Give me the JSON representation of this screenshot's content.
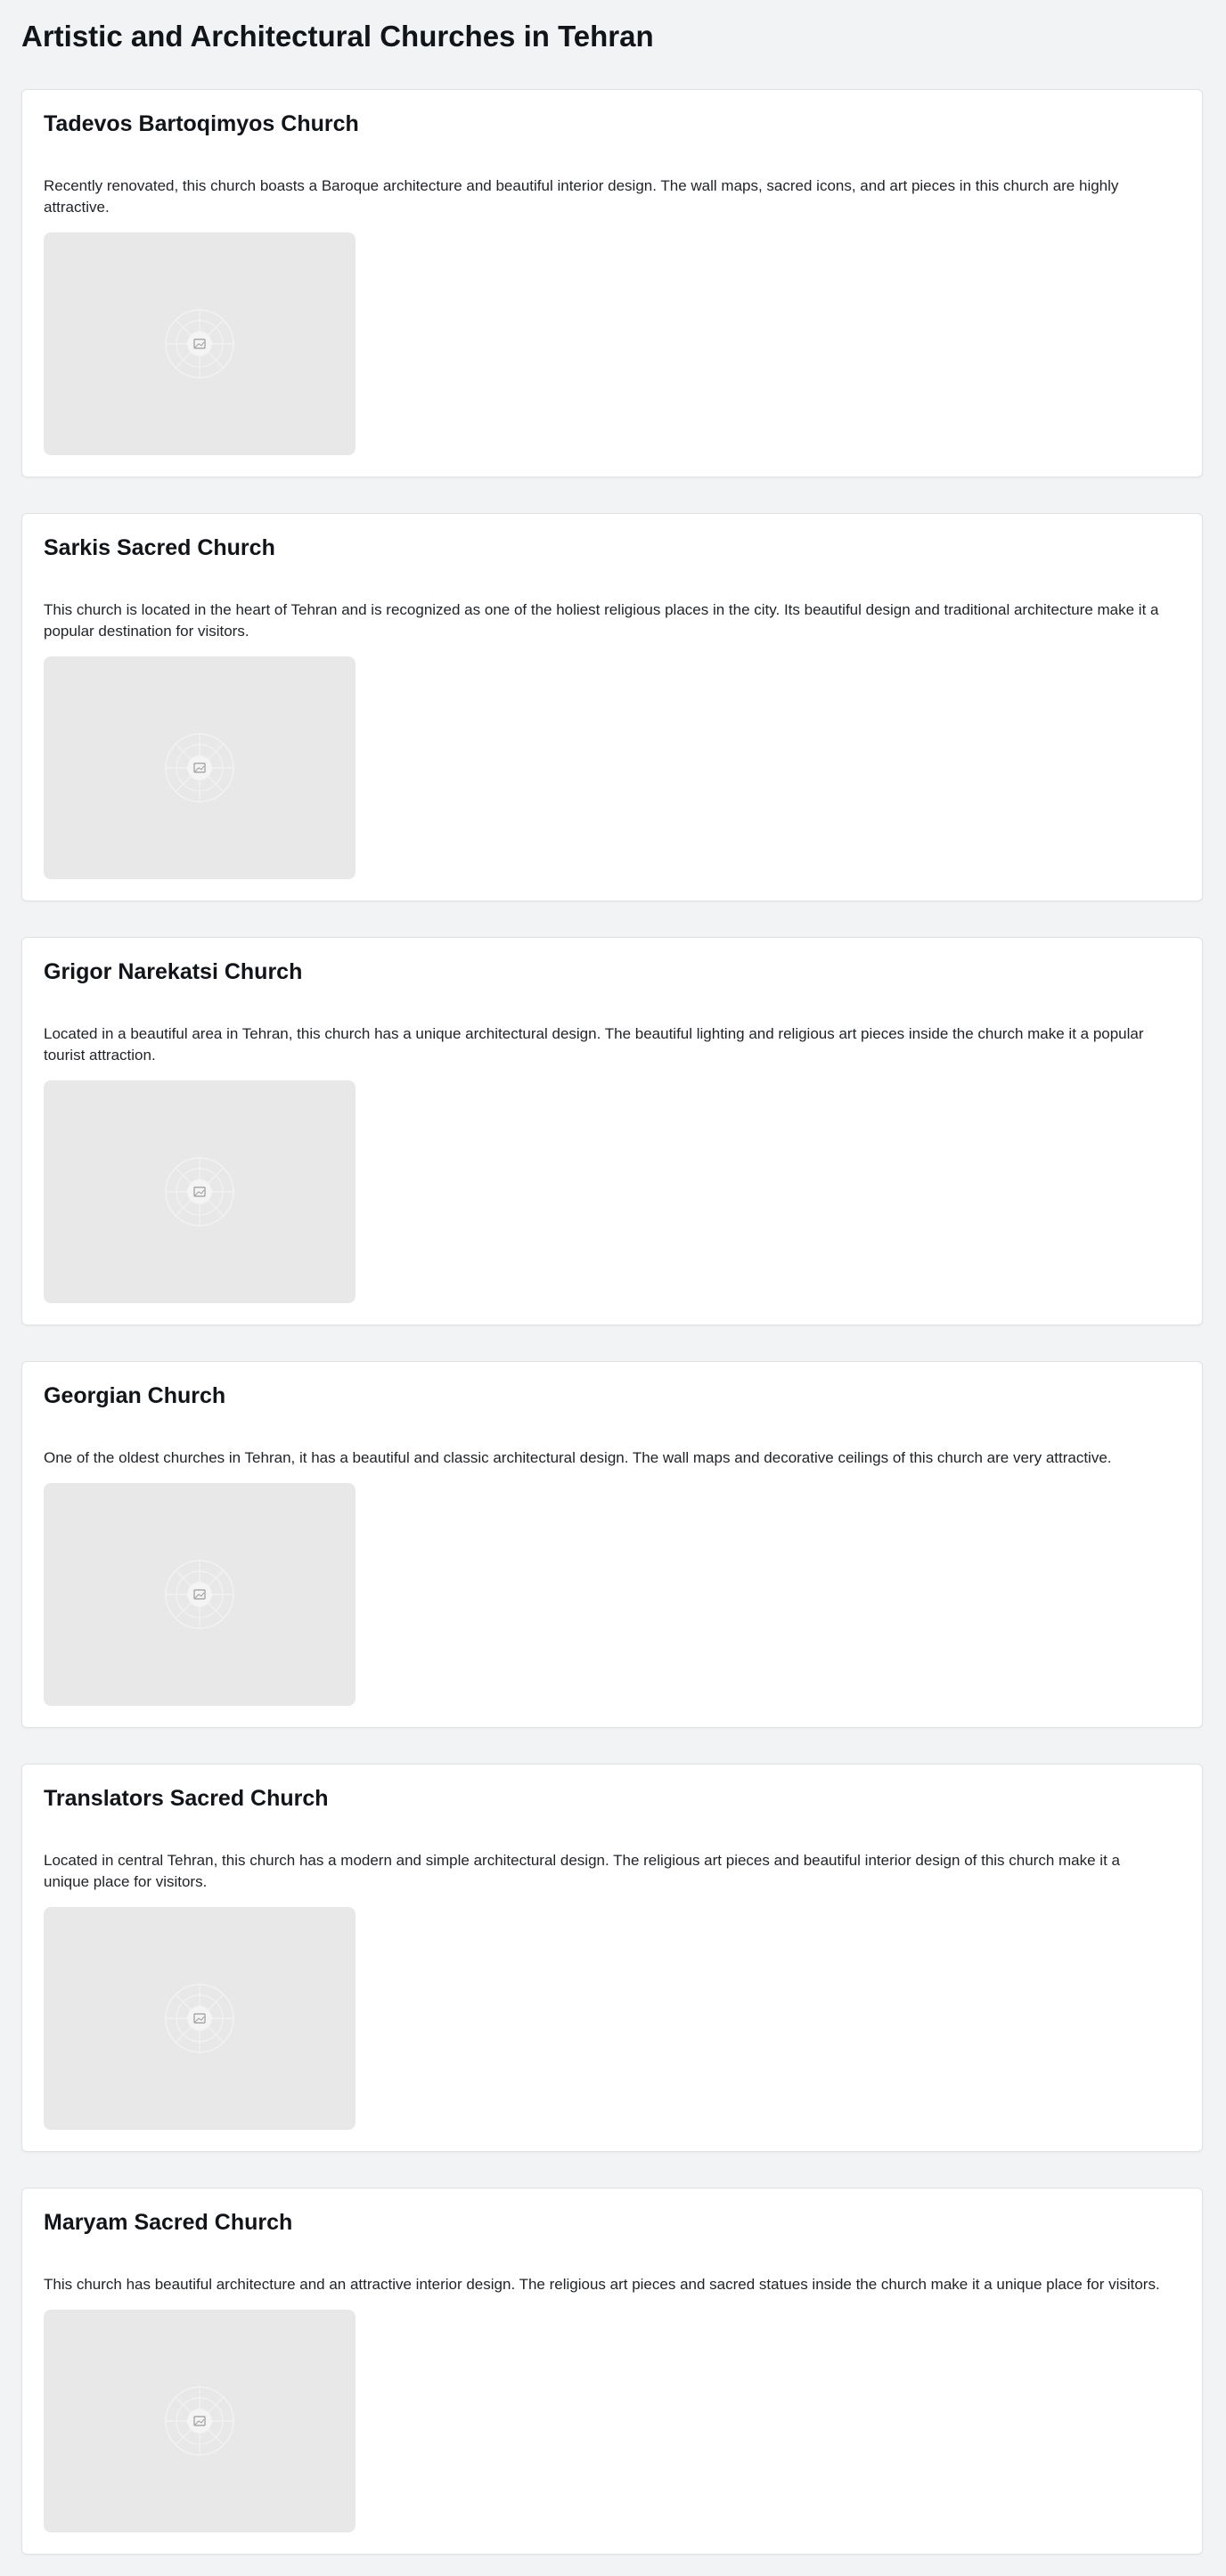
{
  "page": {
    "title": "Artistic and Architectural Churches in Tehran"
  },
  "churches": [
    {
      "name": "Tadevos Bartoqimyos Church",
      "description": "Recently renovated, this church boasts a Baroque architecture and beautiful interior design. The wall maps, sacred icons, and art pieces in this church are highly attractive.",
      "image_icon": "image-placeholder-icon"
    },
    {
      "name": "Sarkis Sacred Church",
      "description": "This church is located in the heart of Tehran and is recognized as one of the holiest religious places in the city. Its beautiful design and traditional architecture make it a popular destination for visitors.",
      "image_icon": "image-placeholder-icon"
    },
    {
      "name": "Grigor Narekatsi Church",
      "description": "Located in a beautiful area in Tehran, this church has a unique architectural design. The beautiful lighting and religious art pieces inside the church make it a popular tourist attraction.",
      "image_icon": "image-placeholder-icon"
    },
    {
      "name": "Georgian Church",
      "description": "One of the oldest churches in Tehran, it has a beautiful and classic architectural design. The wall maps and decorative ceilings of this church are very attractive.",
      "image_icon": "image-placeholder-icon"
    },
    {
      "name": "Translators Sacred Church",
      "description": "Located in central Tehran, this church has a modern and simple architectural design. The religious art pieces and beautiful interior design of this church make it a unique place for visitors.",
      "image_icon": "image-placeholder-icon"
    },
    {
      "name": "Maryam Sacred Church",
      "description": "This church has beautiful architecture and an attractive interior design. The religious art pieces and sacred statues inside the church make it a unique place for visitors.",
      "image_icon": "image-placeholder-icon"
    }
  ],
  "colors": {
    "page_background": "#f2f3f5",
    "card_background": "#ffffff",
    "image_placeholder": "#e8e8e8"
  }
}
